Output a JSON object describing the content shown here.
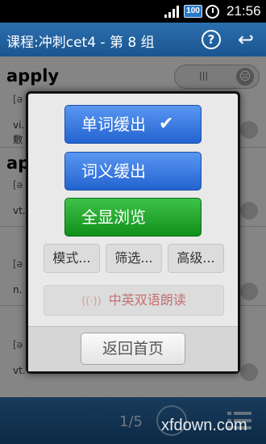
{
  "status_bar": {
    "battery": "100",
    "time": "21:56"
  },
  "title_bar": {
    "title": "课程:冲刺cet4 - 第 8 组",
    "help_icon": "help-circle-icon",
    "back_icon": "back-arrow-icon",
    "help_glyph": "?",
    "back_glyph": "↩"
  },
  "word_list": [
    {
      "word": "apply",
      "phonetic": "[ə",
      "definition": "vi.",
      "definition2": "敷"
    },
    {
      "word": "ap",
      "phonetic": "[ə",
      "definition": "vt."
    },
    {
      "word": "",
      "phonetic": "[ə",
      "definition": "n."
    },
    {
      "word": "",
      "phonetic": "[ə",
      "definition": "vt."
    }
  ],
  "dialog": {
    "word_fade_label": "单词缓出",
    "meaning_fade_label": "词义缓出",
    "browse_all_label": "全显浏览",
    "mode_label": "模式...",
    "filter_label": "筛选...",
    "advanced_label": "高级...",
    "bilingual_read_label": "中英双语朗读",
    "home_label": "返回首页",
    "check_glyph": "✔",
    "wave_glyph": "((·))"
  },
  "bottom_bar": {
    "page": "1/5"
  },
  "watermark": "xfdown.com",
  "colors": {
    "title_bar": "#1f5f9c",
    "blue_button": "#2f73de",
    "green_button": "#1fa52a",
    "read_text": "#c47070"
  }
}
